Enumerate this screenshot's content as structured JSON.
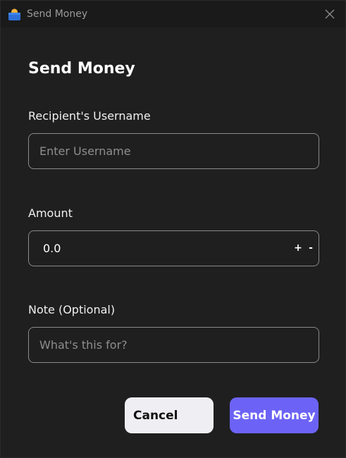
{
  "window": {
    "title": "Send Money"
  },
  "form": {
    "heading": "Send Money",
    "recipient": {
      "label": "Recipient's Username",
      "placeholder": "Enter Username",
      "value": ""
    },
    "amount": {
      "label": "Amount",
      "value": "0.0",
      "increment": "+",
      "decrement": "-"
    },
    "note": {
      "label": "Note (Optional)",
      "placeholder": "What's this for?",
      "value": ""
    }
  },
  "actions": {
    "cancel_label": "Cancel",
    "send_label": "Send Money"
  },
  "colors": {
    "accent": "#6c63f6",
    "background": "#1f1f1f",
    "cancel_bg": "#efeff3"
  },
  "icons": {
    "app": "wallet-icon",
    "close": "close-icon"
  }
}
